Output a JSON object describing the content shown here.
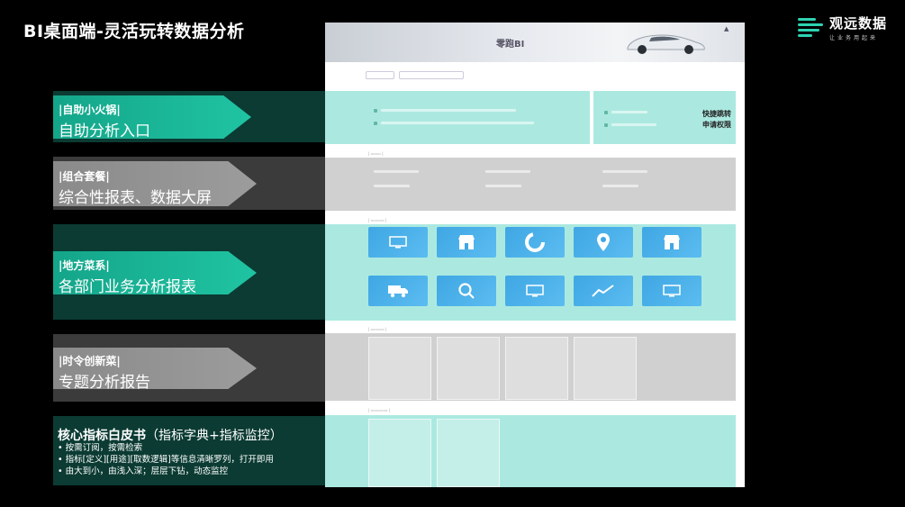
{
  "slide": {
    "title": "BI桌面端-灵活玩转数据分析"
  },
  "brand": {
    "name": "观远数据",
    "tagline": "让业务用起来"
  },
  "mock": {
    "banner_title": "零跑BI",
    "quick_access": [
      "快捷跳转",
      "申请权限"
    ]
  },
  "bands": [
    {
      "tag": "|自助小火锅|",
      "title": "自助分析入口",
      "style": "teal"
    },
    {
      "tag": "|组合套餐|",
      "title": "综合性报表、数据大屏",
      "style": "gray"
    },
    {
      "tag": "|地方菜系|",
      "title": "各部门业务分析报表",
      "style": "teal"
    },
    {
      "tag": "|时令创新菜|",
      "title": "专题分析报告",
      "style": "gray"
    }
  ],
  "core": {
    "title": "核心指标白皮书",
    "subtitle": "（指标字典+指标监控）",
    "bullets": [
      "按需订阅，按需检索",
      "指标[定义][用途][取数逻辑]等信息清晰罗列，打开即用",
      "由大到小，由浅入深；层层下钻，动态监控"
    ]
  },
  "colors": {
    "teal": "#1fc4a2",
    "gray": "#8a8a8a",
    "brand": "#2ed3b2"
  },
  "icons": [
    "brand-logo-icon",
    "car-image-icon",
    "user-icon",
    "monitor-icon",
    "store-icon",
    "pie-chart-icon",
    "map-pin-icon",
    "truck-icon",
    "search-icon",
    "trend-chart-icon"
  ]
}
